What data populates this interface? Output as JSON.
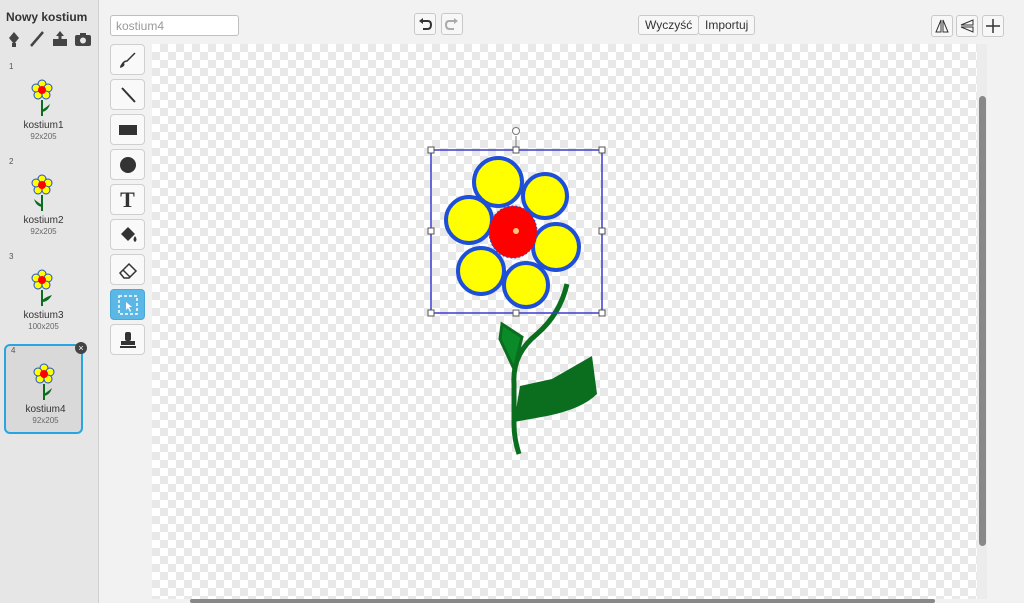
{
  "costume_pane": {
    "title": "Nowy kostium",
    "tools": [
      {
        "icon": "choose-costume-icon"
      },
      {
        "icon": "paint-brush-icon"
      },
      {
        "icon": "upload-icon"
      },
      {
        "icon": "camera-icon"
      }
    ],
    "costumes": [
      {
        "num": "1",
        "name": "kostium1",
        "size": "92x205",
        "selected": false
      },
      {
        "num": "2",
        "name": "kostium2",
        "size": "92x205",
        "selected": false
      },
      {
        "num": "3",
        "name": "kostium3",
        "size": "100x205",
        "selected": false
      },
      {
        "num": "4",
        "name": "kostium4",
        "size": "92x205",
        "selected": true
      }
    ],
    "delete_glyph": "×"
  },
  "editor": {
    "costume_name_value": "kostium4",
    "clear_label": "Wyczyść",
    "import_label": "Importuj",
    "tools": [
      "brush-icon",
      "line-icon",
      "rectangle-icon",
      "ellipse-icon",
      "text-icon",
      "fill-icon",
      "eraser-icon",
      "select-icon",
      "stamp-icon"
    ],
    "active_tool": "select-icon",
    "text_tool_glyph": "T"
  },
  "colors": {
    "selection_accent": "#28a5e0",
    "active_tool_bg": "#5bb8e6",
    "petal_fill": "#ffff00",
    "petal_outline": "#1e4fd8",
    "flower_center": "#ff0000",
    "stem_green": "#0b6e1f"
  }
}
